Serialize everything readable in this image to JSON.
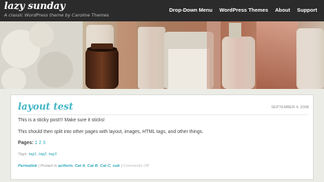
{
  "header": {
    "site_title": "lazy sunday",
    "tagline": "A classic WordPress theme by Caroline Themes",
    "nav": [
      "Drop-Down Menu",
      "WordPress Themes",
      "About",
      "Support"
    ]
  },
  "post": {
    "title": "layout test",
    "date": "SEPTEMBER 4, 2008",
    "paragraph_1": "This is a sticky post!!! Make sure it sticks!",
    "paragraph_2": "This should then split into other pages with layout, images, HTML tags, and other things.",
    "pages_label": "Pages:",
    "pages": [
      "1",
      "2",
      "3"
    ],
    "tags_label": "Tags:",
    "tags": [
      "tag1",
      "tag2",
      "tag3"
    ],
    "meta": {
      "permalink": "Permalink",
      "posted_in": "Posted in",
      "categories": [
        "aciform",
        "Cat A",
        "Cat B",
        "Cat C",
        "sub"
      ],
      "comments": "Comments Off"
    }
  },
  "colors": {
    "topbar": "#2b2b2b",
    "accent": "#42b6c5",
    "link": "#2aa7b8",
    "page_bg": "#ecece6"
  }
}
